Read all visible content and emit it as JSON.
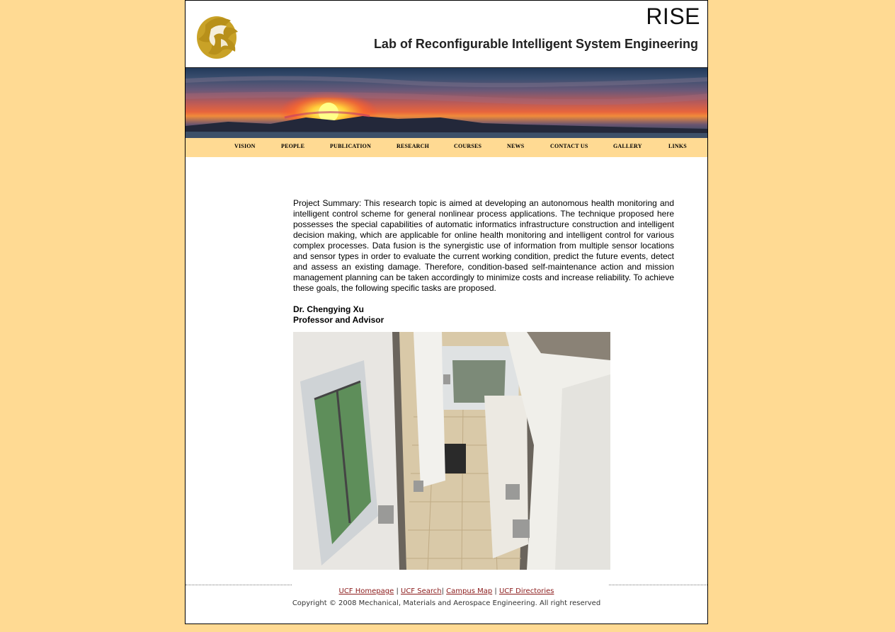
{
  "colors": {
    "page_bg": "#FFDA93",
    "nav_bg": "#FFDA93",
    "link": "#8B1A1A"
  },
  "header": {
    "logo_icon": "pegasus-logo-icon",
    "site_short": "RISE",
    "site_full": "Lab of Reconfigurable Intelligent System Engineering"
  },
  "nav": {
    "items": [
      {
        "label": "VISION"
      },
      {
        "label": "PEOPLE"
      },
      {
        "label": "PUBLICATION"
      },
      {
        "label": "RESEARCH"
      },
      {
        "label": "COURSES"
      },
      {
        "label": "NEWS"
      },
      {
        "label": "CONTACT US"
      },
      {
        "label": "GALLERY"
      },
      {
        "label": "LINKS"
      }
    ]
  },
  "main": {
    "summary": "Project Summary: This research topic is aimed at developing an autonomous health monitoring and intelligent control scheme for general nonlinear process applications. The technique proposed here possesses the special capabilities of automatic informatics infrastructure construction and intelligent decision making, which are applicable for online health monitoring and intelligent control for various complex processes. Data fusion is the synergistic use of information from multiple sensor locations and sensor types in order to evaluate the current working condition, predict the future events, detect and assess an existing damage. Therefore, condition-based self-maintenance action and mission management planning can be taken accordingly to minimize costs and increase reliability. To achieve these goals, the following specific tasks are proposed.",
    "author_name": "Dr. Chengying Xu",
    "author_title": "Professor and Advisor"
  },
  "footer": {
    "links": [
      {
        "label": "UCF Homepage"
      },
      {
        "label": "UCF Search"
      },
      {
        "label": "Campus Map"
      },
      {
        "label": "UCF Directories"
      }
    ],
    "copyright": "Copyright © 2008 Mechanical, Materials and Aerospace Engineering. All right reserved"
  }
}
